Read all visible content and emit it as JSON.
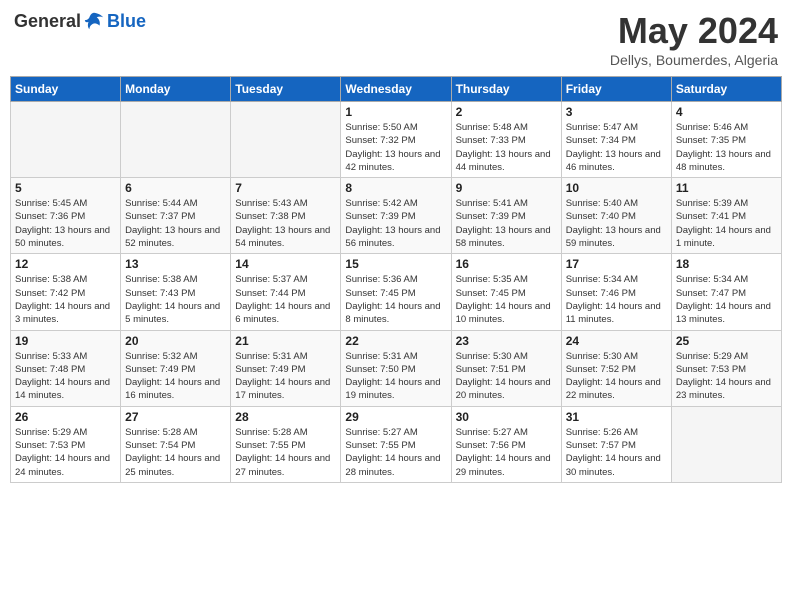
{
  "logo": {
    "general": "General",
    "blue": "Blue"
  },
  "title": "May 2024",
  "location": "Dellys, Boumerdes, Algeria",
  "days_of_week": [
    "Sunday",
    "Monday",
    "Tuesday",
    "Wednesday",
    "Thursday",
    "Friday",
    "Saturday"
  ],
  "weeks": [
    [
      {
        "day": "",
        "sunrise": "",
        "sunset": "",
        "daylight": ""
      },
      {
        "day": "",
        "sunrise": "",
        "sunset": "",
        "daylight": ""
      },
      {
        "day": "",
        "sunrise": "",
        "sunset": "",
        "daylight": ""
      },
      {
        "day": "1",
        "sunrise": "Sunrise: 5:50 AM",
        "sunset": "Sunset: 7:32 PM",
        "daylight": "Daylight: 13 hours and 42 minutes."
      },
      {
        "day": "2",
        "sunrise": "Sunrise: 5:48 AM",
        "sunset": "Sunset: 7:33 PM",
        "daylight": "Daylight: 13 hours and 44 minutes."
      },
      {
        "day": "3",
        "sunrise": "Sunrise: 5:47 AM",
        "sunset": "Sunset: 7:34 PM",
        "daylight": "Daylight: 13 hours and 46 minutes."
      },
      {
        "day": "4",
        "sunrise": "Sunrise: 5:46 AM",
        "sunset": "Sunset: 7:35 PM",
        "daylight": "Daylight: 13 hours and 48 minutes."
      }
    ],
    [
      {
        "day": "5",
        "sunrise": "Sunrise: 5:45 AM",
        "sunset": "Sunset: 7:36 PM",
        "daylight": "Daylight: 13 hours and 50 minutes."
      },
      {
        "day": "6",
        "sunrise": "Sunrise: 5:44 AM",
        "sunset": "Sunset: 7:37 PM",
        "daylight": "Daylight: 13 hours and 52 minutes."
      },
      {
        "day": "7",
        "sunrise": "Sunrise: 5:43 AM",
        "sunset": "Sunset: 7:38 PM",
        "daylight": "Daylight: 13 hours and 54 minutes."
      },
      {
        "day": "8",
        "sunrise": "Sunrise: 5:42 AM",
        "sunset": "Sunset: 7:39 PM",
        "daylight": "Daylight: 13 hours and 56 minutes."
      },
      {
        "day": "9",
        "sunrise": "Sunrise: 5:41 AM",
        "sunset": "Sunset: 7:39 PM",
        "daylight": "Daylight: 13 hours and 58 minutes."
      },
      {
        "day": "10",
        "sunrise": "Sunrise: 5:40 AM",
        "sunset": "Sunset: 7:40 PM",
        "daylight": "Daylight: 13 hours and 59 minutes."
      },
      {
        "day": "11",
        "sunrise": "Sunrise: 5:39 AM",
        "sunset": "Sunset: 7:41 PM",
        "daylight": "Daylight: 14 hours and 1 minute."
      }
    ],
    [
      {
        "day": "12",
        "sunrise": "Sunrise: 5:38 AM",
        "sunset": "Sunset: 7:42 PM",
        "daylight": "Daylight: 14 hours and 3 minutes."
      },
      {
        "day": "13",
        "sunrise": "Sunrise: 5:38 AM",
        "sunset": "Sunset: 7:43 PM",
        "daylight": "Daylight: 14 hours and 5 minutes."
      },
      {
        "day": "14",
        "sunrise": "Sunrise: 5:37 AM",
        "sunset": "Sunset: 7:44 PM",
        "daylight": "Daylight: 14 hours and 6 minutes."
      },
      {
        "day": "15",
        "sunrise": "Sunrise: 5:36 AM",
        "sunset": "Sunset: 7:45 PM",
        "daylight": "Daylight: 14 hours and 8 minutes."
      },
      {
        "day": "16",
        "sunrise": "Sunrise: 5:35 AM",
        "sunset": "Sunset: 7:45 PM",
        "daylight": "Daylight: 14 hours and 10 minutes."
      },
      {
        "day": "17",
        "sunrise": "Sunrise: 5:34 AM",
        "sunset": "Sunset: 7:46 PM",
        "daylight": "Daylight: 14 hours and 11 minutes."
      },
      {
        "day": "18",
        "sunrise": "Sunrise: 5:34 AM",
        "sunset": "Sunset: 7:47 PM",
        "daylight": "Daylight: 14 hours and 13 minutes."
      }
    ],
    [
      {
        "day": "19",
        "sunrise": "Sunrise: 5:33 AM",
        "sunset": "Sunset: 7:48 PM",
        "daylight": "Daylight: 14 hours and 14 minutes."
      },
      {
        "day": "20",
        "sunrise": "Sunrise: 5:32 AM",
        "sunset": "Sunset: 7:49 PM",
        "daylight": "Daylight: 14 hours and 16 minutes."
      },
      {
        "day": "21",
        "sunrise": "Sunrise: 5:31 AM",
        "sunset": "Sunset: 7:49 PM",
        "daylight": "Daylight: 14 hours and 17 minutes."
      },
      {
        "day": "22",
        "sunrise": "Sunrise: 5:31 AM",
        "sunset": "Sunset: 7:50 PM",
        "daylight": "Daylight: 14 hours and 19 minutes."
      },
      {
        "day": "23",
        "sunrise": "Sunrise: 5:30 AM",
        "sunset": "Sunset: 7:51 PM",
        "daylight": "Daylight: 14 hours and 20 minutes."
      },
      {
        "day": "24",
        "sunrise": "Sunrise: 5:30 AM",
        "sunset": "Sunset: 7:52 PM",
        "daylight": "Daylight: 14 hours and 22 minutes."
      },
      {
        "day": "25",
        "sunrise": "Sunrise: 5:29 AM",
        "sunset": "Sunset: 7:53 PM",
        "daylight": "Daylight: 14 hours and 23 minutes."
      }
    ],
    [
      {
        "day": "26",
        "sunrise": "Sunrise: 5:29 AM",
        "sunset": "Sunset: 7:53 PM",
        "daylight": "Daylight: 14 hours and 24 minutes."
      },
      {
        "day": "27",
        "sunrise": "Sunrise: 5:28 AM",
        "sunset": "Sunset: 7:54 PM",
        "daylight": "Daylight: 14 hours and 25 minutes."
      },
      {
        "day": "28",
        "sunrise": "Sunrise: 5:28 AM",
        "sunset": "Sunset: 7:55 PM",
        "daylight": "Daylight: 14 hours and 27 minutes."
      },
      {
        "day": "29",
        "sunrise": "Sunrise: 5:27 AM",
        "sunset": "Sunset: 7:55 PM",
        "daylight": "Daylight: 14 hours and 28 minutes."
      },
      {
        "day": "30",
        "sunrise": "Sunrise: 5:27 AM",
        "sunset": "Sunset: 7:56 PM",
        "daylight": "Daylight: 14 hours and 29 minutes."
      },
      {
        "day": "31",
        "sunrise": "Sunrise: 5:26 AM",
        "sunset": "Sunset: 7:57 PM",
        "daylight": "Daylight: 14 hours and 30 minutes."
      },
      {
        "day": "",
        "sunrise": "",
        "sunset": "",
        "daylight": ""
      }
    ]
  ]
}
